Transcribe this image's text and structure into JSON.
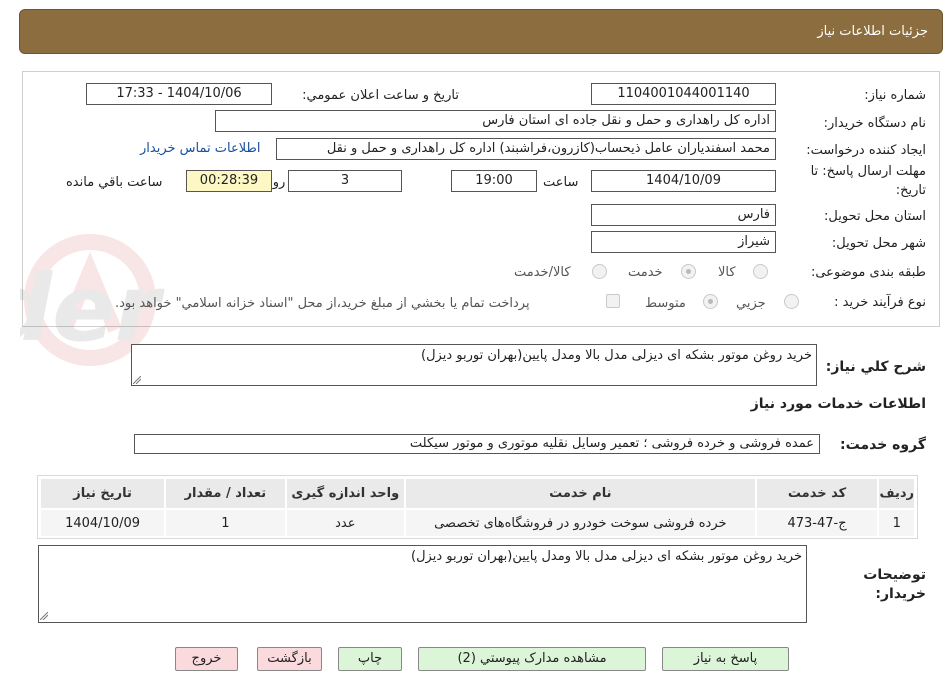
{
  "header": {
    "title": "جزئیات اطلاعات نیاز"
  },
  "form": {
    "need_number_label": "شماره نیاز:",
    "need_number": "1104001044001140",
    "announce_label": "تاریخ و ساعت اعلان عمومي:",
    "announce_value": "1404/10/06 - 17:33",
    "buyer_org_label": "نام دستگاه خريدار:",
    "buyer_org": "اداره کل راهداری و حمل و نقل جاده ای استان فارس",
    "requester_label": "ايجاد کننده درخواست:",
    "requester": "محمد اسفندیاران عامل ذیحساب(کازرون،فراشبند) اداره کل راهداری و حمل و نقل",
    "contact_link": "اطلاعات تماس خريدار",
    "deadline_label_1": "مهلت ارسال پاسخ: تا",
    "deadline_label_2": "تاريخ:",
    "deadline_date": "1404/10/09",
    "time_label": "ساعت",
    "deadline_time": "19:00",
    "days": "3",
    "days_label": "روز و",
    "remaining": "00:28:39",
    "remaining_label": "ساعت باقي مانده",
    "province_label": "استان محل تحويل:",
    "province": "فارس",
    "city_label": "شهر محل تحويل:",
    "city": "شيراز",
    "category_label": "طبقه بندی موضوعی:",
    "category_options": [
      "کالا",
      "خدمت",
      "کالا/خدمت"
    ],
    "category_selected": "خدمت",
    "process_label": "نوع فرآيند خريد :",
    "process_options": [
      "جزيي",
      "متوسط"
    ],
    "process_selected": "متوسط",
    "payment_note": "پرداخت تمام يا بخشي از مبلغ خريد،از محل \"اسناد خزانه اسلامي\" خواهد بود."
  },
  "summary": {
    "label": "شرح کلي نياز:",
    "text": "خرید روغن موتور بشکه ای دیزلی مدل بالا ومدل پایین(بهران توربو دیزل)"
  },
  "services": {
    "section_title": "اطلاعات خدمات مورد نياز",
    "group_label": "گروه خدمت:",
    "group_value": "عمده فروشی و خرده فروشی ؛ تعمیر وسایل نقلیه موتوری و موتور سیکلت",
    "columns": [
      "رديف",
      "کد خدمت",
      "نام خدمت",
      "واحد اندازه گيری",
      "تعداد / مقدار",
      "تاريخ نياز"
    ],
    "rows": [
      {
        "row": "1",
        "code": "ج-47-473",
        "name": "خرده فروشی سوخت خودرو در فروشگاه‌های تخصصی",
        "unit": "عدد",
        "qty": "1",
        "date": "1404/10/09"
      }
    ]
  },
  "buyer_notes": {
    "label_1": "توضيحات",
    "label_2": "خريدار:",
    "text": "خرید روغن موتور بشکه ای دیزلی مدل بالا ومدل پایین(بهران توربو دیزل)"
  },
  "buttons": {
    "reply": "پاسخ به نياز",
    "attachments": "مشاهده مدارک پيوستي (2)",
    "print": "چاپ",
    "back": "بازگشت",
    "exit": "خروج"
  },
  "colors": {
    "header_bg": "#8b6d3f",
    "link": "#1a4fa0",
    "green_btn": "#dcf5d8",
    "red_btn": "#fadadd",
    "timer_bg": "#fdf7c3"
  }
}
